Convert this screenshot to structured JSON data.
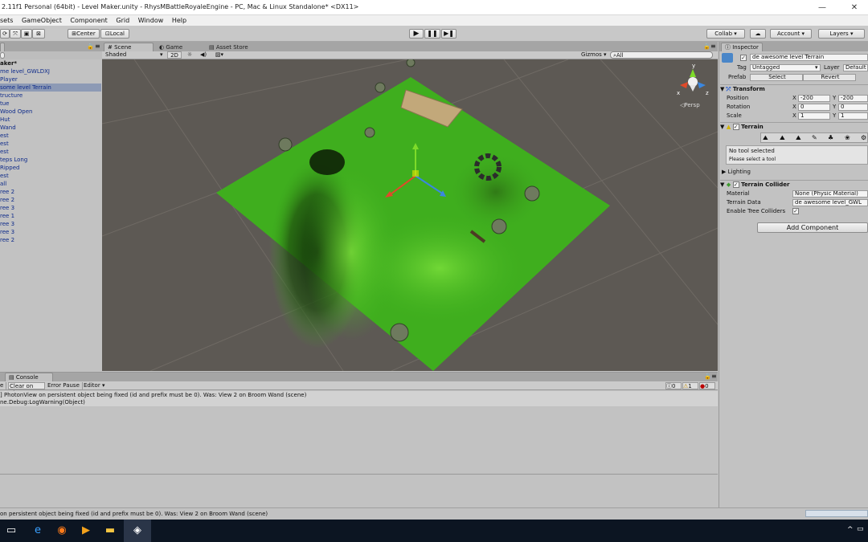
{
  "window": {
    "title": "2.11f1 Personal (64bit) - Level Maker.unity - RhysMBattleRoyaleEngine - PC, Mac & Linux Standalone* <DX11>",
    "minimize": "—",
    "close": "✕"
  },
  "menu": [
    "sets",
    "GameObject",
    "Component",
    "Grid",
    "Window",
    "Help"
  ],
  "toolbar": {
    "center": "Center",
    "local": "Local",
    "collab": "Collab ▾",
    "account": "Account",
    "layers": "Layers"
  },
  "hierarchy": {
    "tab": "",
    "scene_name": "aker*",
    "items": [
      "me level_GWLDXJ",
      "Player",
      "some level Terrain",
      "tructure",
      "tue",
      "Wood Open",
      "Hut",
      "Wand",
      "est",
      "est",
      "est",
      "teps Long",
      "Ripped",
      "est",
      "all",
      "ree 2",
      "ree 2",
      "ree 3",
      "ree 1",
      "ree 3",
      "ree 3",
      "ree 2"
    ],
    "selected_index": 2
  },
  "scene": {
    "tab_scene": "Scene",
    "tab_game": "Game",
    "tab_asset_store": "Asset Store",
    "shading": "Shaded",
    "mode2d": "2D",
    "gizmos": "Gizmos",
    "search_placeholder": "All",
    "persp": "Persp",
    "axis_y": "y",
    "axis_x": "x",
    "axis_z": "z"
  },
  "inspector": {
    "tab": "Inspector",
    "object_name": "de awesome level Terrain",
    "tag_label": "Tag",
    "tag_value": "Untagged",
    "layer_label": "Layer",
    "layer_value": "Default",
    "prefab_label": "Prefab",
    "prefab_select": "Select",
    "prefab_revert": "Revert",
    "transform": {
      "header": "Transform",
      "position_label": "Position",
      "rotation_label": "Rotation",
      "scale_label": "Scale",
      "pos_x": "-200",
      "pos_y": "-200",
      "rot_x": "0",
      "rot_y": "0",
      "scale_x": "1",
      "scale_y": "1"
    },
    "terrain": {
      "header": "Terrain",
      "no_tool": "No tool selected",
      "please_select": "Please select a tool",
      "lighting": "Lighting"
    },
    "collider": {
      "header": "Terrain Collider",
      "material_label": "Material",
      "material_value": "None (Physic Material)",
      "data_label": "Terrain Data",
      "data_value": "de awesome level_GWL",
      "trees_label": "Enable Tree Colliders"
    },
    "add_component": "Add Component"
  },
  "console": {
    "tab": "Console",
    "btn_clear": "e",
    "btn_clear_on_play": "Clear on Play",
    "btn_error_pause": "Error Pause",
    "btn_editor": "Editor ▾",
    "count_info": "0",
    "count_warn": "1",
    "count_error": "0",
    "line1": "] PhotonView on persistent object being fixed (id and prefix must be 0). Was: View 2 on Broom Wand (scene)",
    "line2": "ne.Debug:LogWarning(Object)"
  },
  "statusbar": {
    "message": "on persistent object being fixed (id and prefix must be 0). Was: View 2 on Broom Wand (scene)"
  },
  "colors": {
    "terrain_green": "#3fae1e",
    "editor_grey": "#c2c2c2",
    "scene_bg": "#5d5954",
    "taskbar": "#0c1522"
  }
}
